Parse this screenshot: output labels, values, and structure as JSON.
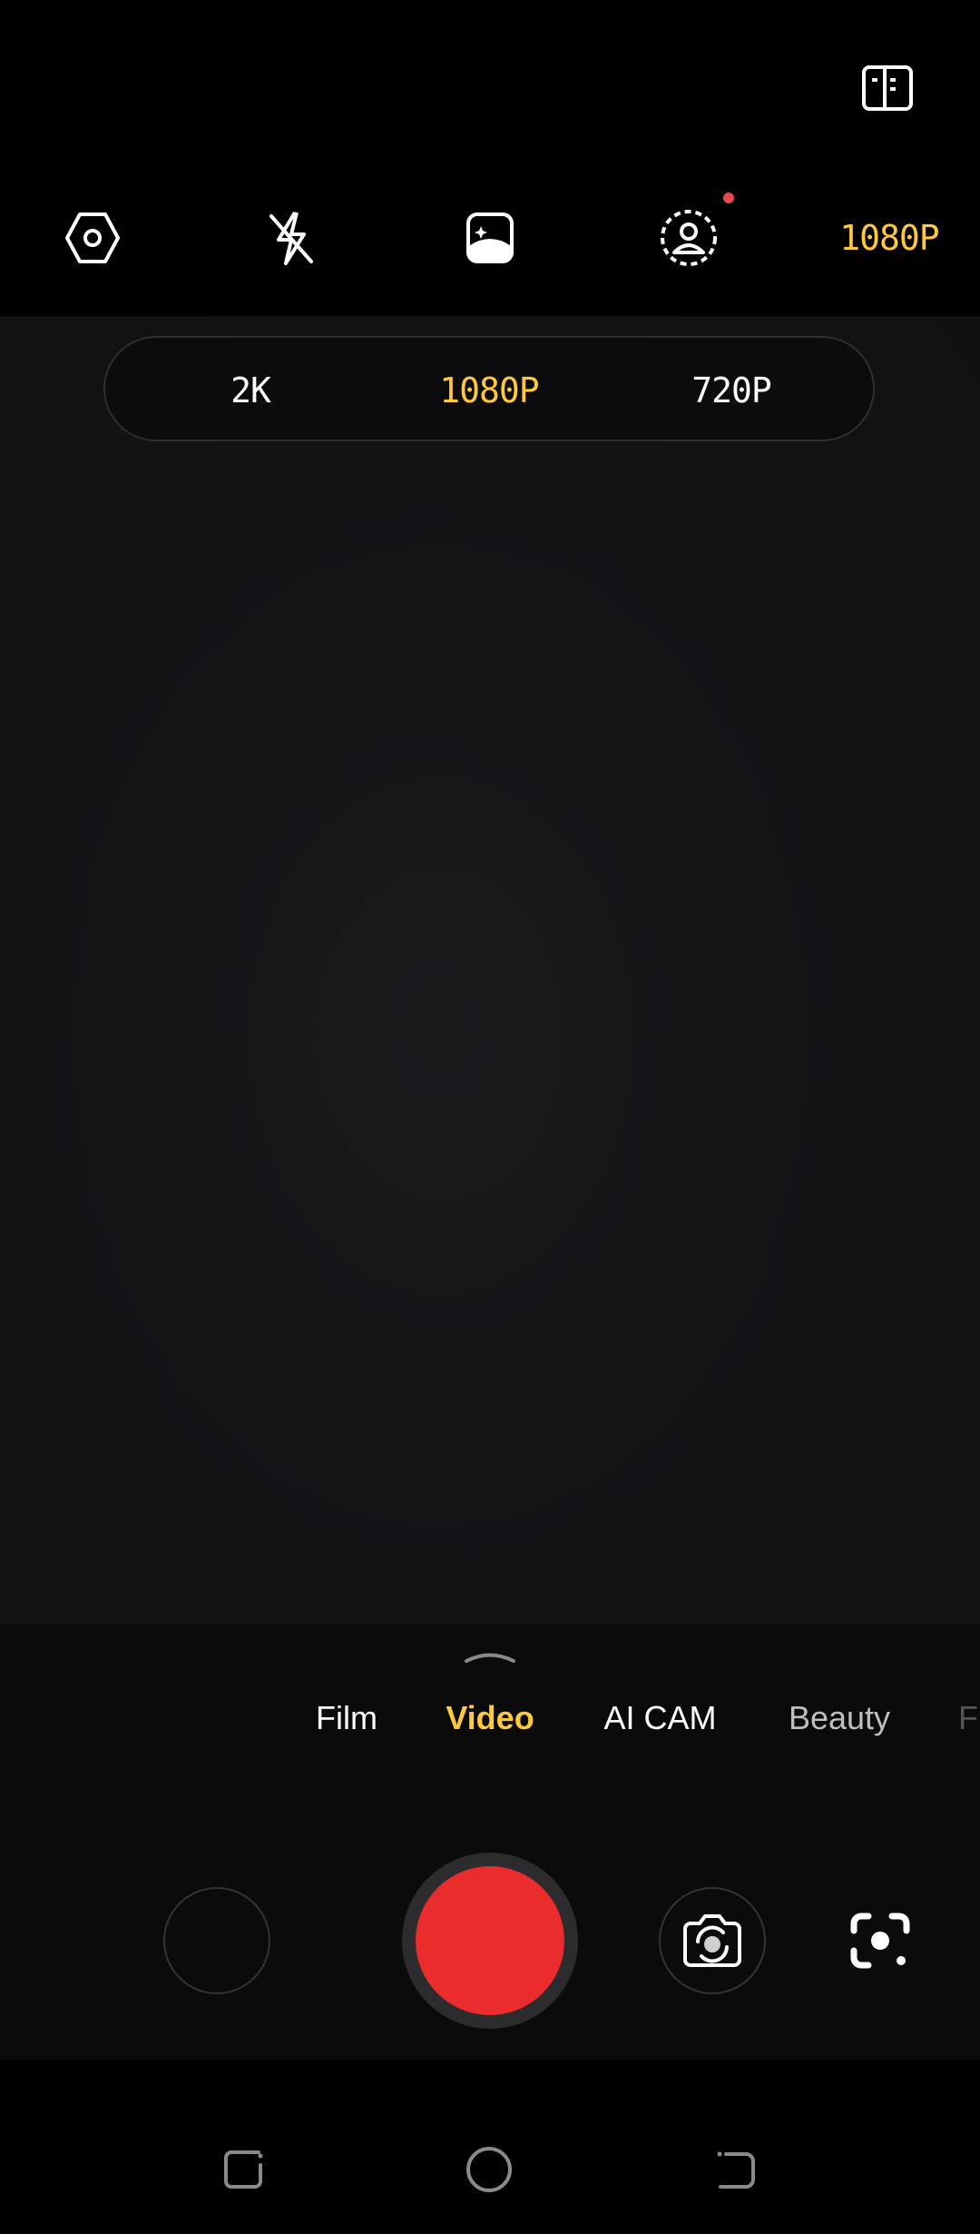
{
  "colors": {
    "accent": "#FFC83D",
    "record": "#EA2C2C",
    "notification_dot": "#E5484D",
    "text": "#FFFFFF",
    "text_dim": "#BFBFBF"
  },
  "top_bar": {
    "guide_icon": "book-guide-icon",
    "icons": [
      "settings-hexagon-icon",
      "flash-off-icon",
      "filter-icon",
      "portrait-effect-icon"
    ],
    "current_resolution": "1080P"
  },
  "resolution_menu": {
    "options": [
      "2K",
      "1080P",
      "720P"
    ],
    "selected": "1080P"
  },
  "modes": {
    "items": [
      "Film",
      "Video",
      "AI CAM",
      "Beauty",
      "F"
    ],
    "selected": "Video"
  },
  "controls": {
    "gallery": "gallery-thumbnail",
    "record": "record-icon",
    "switch_camera": "switch-camera-icon",
    "lens": "google-lens-icon"
  },
  "nav": [
    "recent-apps-icon",
    "home-icon",
    "back-icon"
  ]
}
